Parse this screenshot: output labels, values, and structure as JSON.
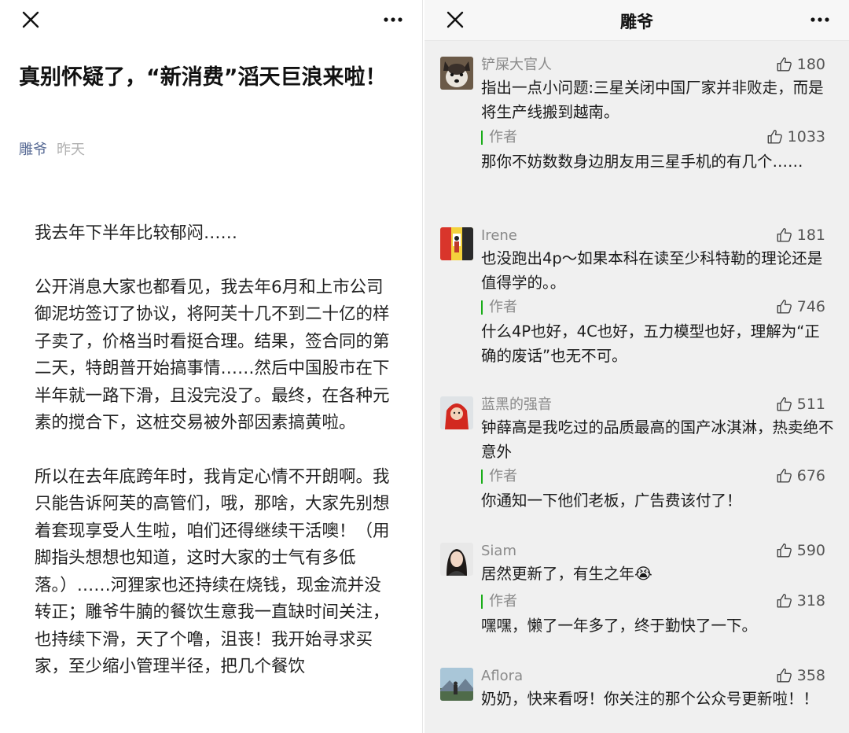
{
  "article": {
    "title": "真别怀疑了，“新消费”滔天巨浪来啦！",
    "author": "雕爷",
    "date": "昨天",
    "paragraphs": [
      "我去年下半年比较郁闷……",
      "公开消息大家也都看见，我去年6月和上市公司御泥坊签订了协议，将阿芙十几不到二十亿的样子卖了，价格当时看挺合理。结果，签合同的第二天，特朗普开始搞事情……然后中国股市在下半年就一路下滑，且没完没了。最终，在各种元素的搅合下，这桩交易被外部因素搞黄啦。",
      "所以在去年底跨年时，我肯定心情不开朗啊。我只能告诉阿芙的高管们，哦，那啥，大家先别想着套现享受人生啦，咱们还得继续干活噢！（用脚指头想想也知道，这时大家的士气有多低落。）……河狸家也还持续在烧钱，现金流并没转正；雕爷牛腩的餐饮生意我一直缺时间关注，也持续下滑，天了个噜，沮丧！我开始寻求买家，至少缩小管理半径，把几个餐饮"
    ]
  },
  "comments_panel": {
    "title": "雕爷",
    "author_tag_label": "作者",
    "comments": [
      {
        "name": "铲屎大官人",
        "likes": "180",
        "text": "指出一点小问题:三星关闭中国厂家并非败走，而是将生产线搬到越南。",
        "reply_likes": "1033",
        "reply": "那你不妨数数身边朋友用三星手机的有几个……",
        "avatar": "husky-dog-avatar"
      },
      {
        "name": "Irene",
        "likes": "181",
        "text": "也没跑出4p～如果本科在读至少科特勒的理论还是值得学的。。",
        "reply_likes": "746",
        "reply": "什么4P也好，4C也好，五力模型也好，理解为“正确的废话”也无不可。",
        "avatar": "photo-collage-avatar"
      },
      {
        "name": "蓝黑的强音",
        "likes": "511",
        "text": "钟薛高是我吃过的品质最高的国产冰淇淋，热卖绝不意外",
        "reply_likes": "676",
        "reply": "你通知一下他们老板，广告费该付了！",
        "avatar": "red-hood-child-avatar"
      },
      {
        "name": "Siam",
        "likes": "590",
        "text": "居然更新了，有生之年😭",
        "reply_likes": "318",
        "reply": "嘿嘿，懒了一年多了，终于勤快了一下。",
        "avatar": "woman-portrait-avatar"
      },
      {
        "name": "Aflora",
        "likes": "358",
        "text": "奶奶，快来看呀！你关注的那个公众号更新啦！！",
        "avatar": "landscape-person-avatar"
      }
    ]
  },
  "colors": {
    "author_link": "#586b95",
    "author_tag_bar": "#1aad19",
    "panel_bg": "#f0f0f0"
  }
}
